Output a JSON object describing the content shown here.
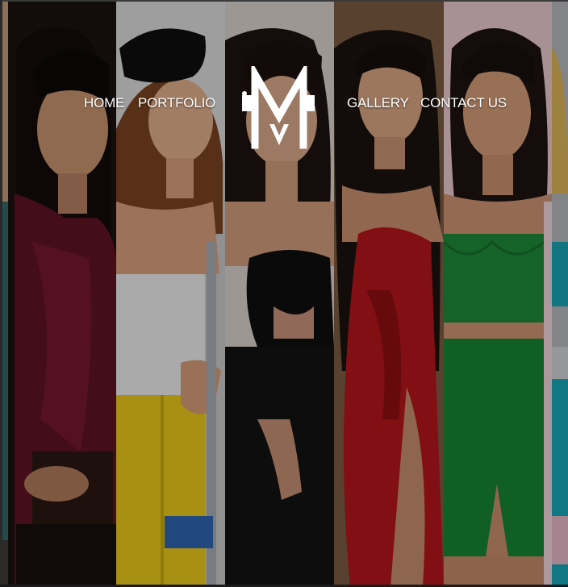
{
  "nav": {
    "home": "HOME",
    "portfolio": "PORTFOLIO",
    "gallery": "GALLERY",
    "contact": "CONTACT US"
  },
  "colors": {
    "nav_text": "#ffffff",
    "overlay": "rgba(0,0,0,0.28)",
    "strip_backgrounds": [
      "#3d3a36",
      "#1a1310",
      "#dcdcdc",
      "#d8d2cc",
      "#7a5a42",
      "#e8c9cf",
      "#b5b8bd"
    ],
    "outfits": [
      "teal",
      "burgundy velvet",
      "white top / yellow jeans",
      "black cut-out dress",
      "red dress",
      "green velvet set",
      "teal top"
    ]
  },
  "logo_icon": "m-monogram-logo-icon",
  "gallery_strips": [
    "model-photo-strip-1",
    "model-photo-strip-2",
    "model-photo-strip-3",
    "model-photo-strip-4",
    "model-photo-strip-5",
    "model-photo-strip-6",
    "model-photo-strip-7"
  ]
}
